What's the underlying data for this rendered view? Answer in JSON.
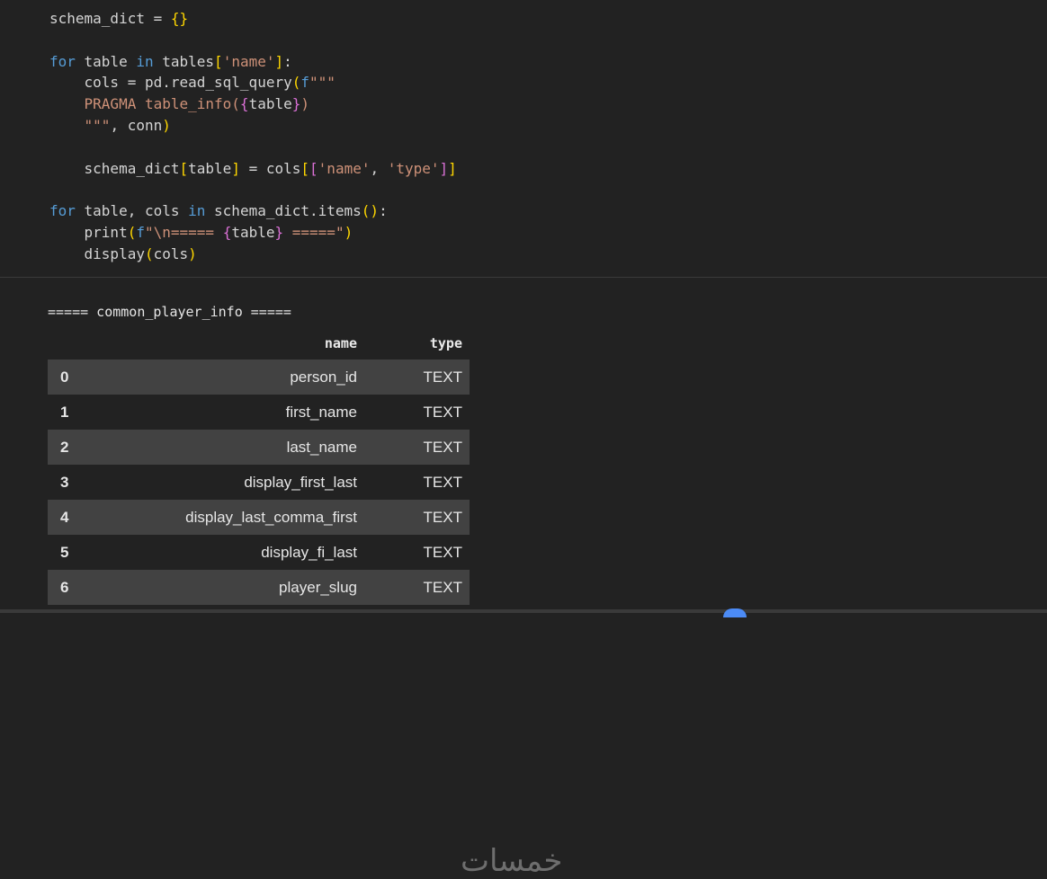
{
  "code_lines": [
    "schema_dict = {}",
    "",
    "for table in tables['name']:",
    "    cols = pd.read_sql_query(f\"\"\"",
    "    PRAGMA table_info({table})",
    "    \"\"\", conn)",
    "",
    "    schema_dict[table] = cols[['name', 'type']]",
    "",
    "for table, cols in schema_dict.items():",
    "    print(f\"\\n===== {table} =====\")",
    "    display(cols)"
  ],
  "output": {
    "header": "===== common_player_info =====",
    "columns": [
      "name",
      "type"
    ],
    "rows": [
      {
        "index": "0",
        "name": "person_id",
        "type": "TEXT"
      },
      {
        "index": "1",
        "name": "first_name",
        "type": "TEXT"
      },
      {
        "index": "2",
        "name": "last_name",
        "type": "TEXT"
      },
      {
        "index": "3",
        "name": "display_first_last",
        "type": "TEXT"
      },
      {
        "index": "4",
        "name": "display_last_comma_first",
        "type": "TEXT"
      },
      {
        "index": "5",
        "name": "display_fi_last",
        "type": "TEXT"
      },
      {
        "index": "6",
        "name": "player_slug",
        "type": "TEXT"
      }
    ]
  },
  "watermark": "خمسات",
  "colors": {
    "background": "#222222",
    "keyword": "#569cd6",
    "string": "#ce9178",
    "bracket_gold": "#ffd700",
    "bracket_purple": "#da70d6",
    "bracket_blue": "#179fff",
    "row_stripe": "#424242"
  }
}
